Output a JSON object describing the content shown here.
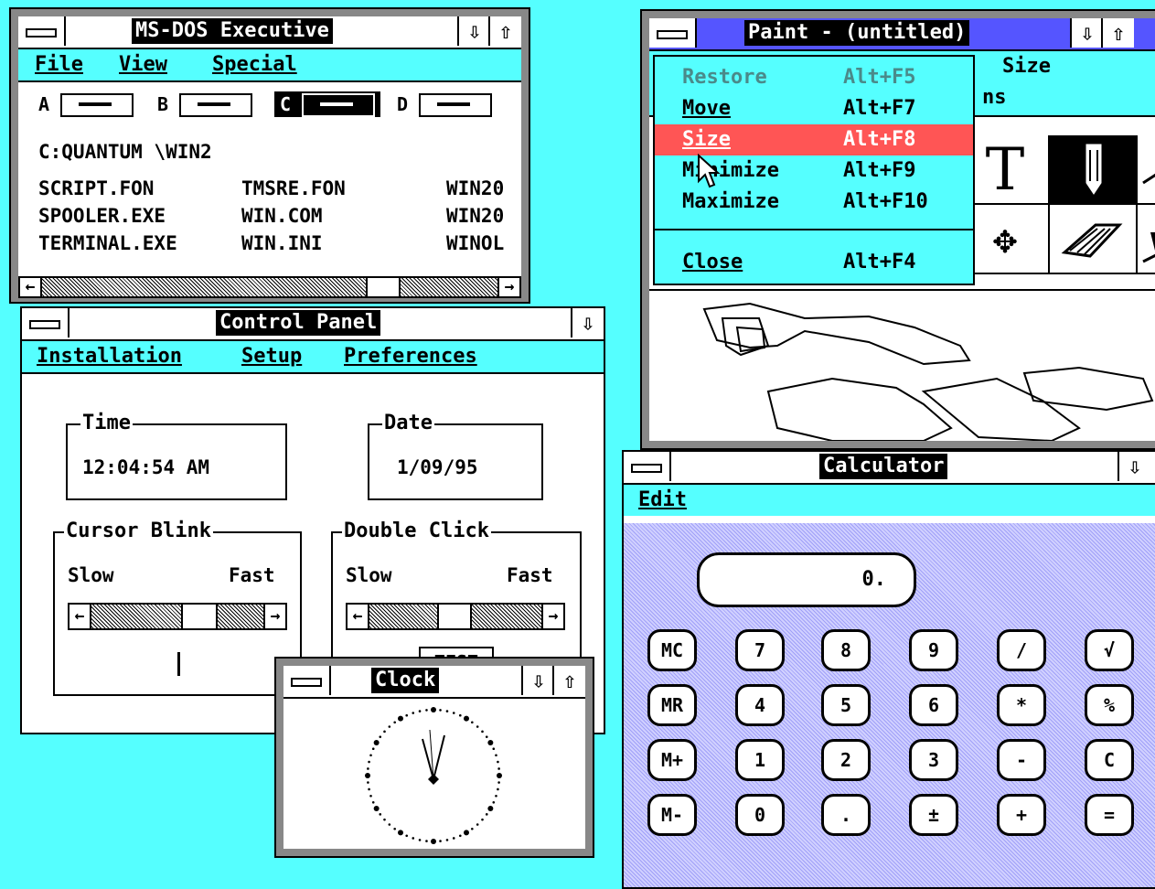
{
  "desktop": {
    "background": "#55ffff"
  },
  "msdos": {
    "title": "MS-DOS Executive",
    "menu": [
      "File",
      "View",
      "Special"
    ],
    "drives": [
      "A",
      "B",
      "C",
      "D"
    ],
    "path": "C:QUANTUM \\WIN2",
    "files": [
      [
        "SCRIPT.FON",
        "TMSRE.FON",
        "WIN20"
      ],
      [
        "SPOOLER.EXE",
        "WIN.COM",
        "WIN20"
      ],
      [
        "TERMINAL.EXE",
        "WIN.INI",
        "WINOL"
      ]
    ]
  },
  "control_panel": {
    "title": "Control Panel",
    "menu": [
      "Installation",
      "Setup",
      "Preferences"
    ],
    "time_label": "Time",
    "time_value": "12:04:54 AM",
    "date_label": "Date",
    "date_value": "1/09/95",
    "cursor_blink_label": "Cursor Blink",
    "double_click_label": "Double Click",
    "slow": "Slow",
    "fast": "Fast",
    "test_label": "TEST"
  },
  "clock": {
    "title": "Clock"
  },
  "paint": {
    "title": "Paint - (untitled)",
    "menu_fragment": "Size",
    "menu_fragment2": "ns",
    "system_menu": [
      {
        "label": "Restore",
        "key": "Alt+F5",
        "state": "disabled"
      },
      {
        "label": "Move",
        "key": "Alt+F7",
        "state": "normal"
      },
      {
        "label": "Size",
        "key": "Alt+F8",
        "state": "highlighted"
      },
      {
        "label": "Minimize",
        "key": "Alt+F9",
        "state": "normal"
      },
      {
        "label": "Maximize",
        "key": "Alt+F10",
        "state": "normal"
      },
      {
        "label": "Close",
        "key": "Alt+F4",
        "state": "normal"
      }
    ],
    "tool_text": "T"
  },
  "calculator": {
    "title": "Calculator",
    "menu": [
      "Edit"
    ],
    "display": "0.",
    "keys": [
      [
        "MC",
        "7",
        "8",
        "9",
        "/",
        "√"
      ],
      [
        "MR",
        "4",
        "5",
        "6",
        "*",
        "%"
      ],
      [
        "M+",
        "1",
        "2",
        "3",
        "-",
        "C"
      ],
      [
        "M-",
        "0",
        ".",
        "±",
        "+",
        "="
      ]
    ]
  },
  "colors": {
    "accent": "#55ffff",
    "highlight": "#ff5555",
    "paint_title": "#5555ff",
    "calc_body": "#a8a8ff"
  }
}
